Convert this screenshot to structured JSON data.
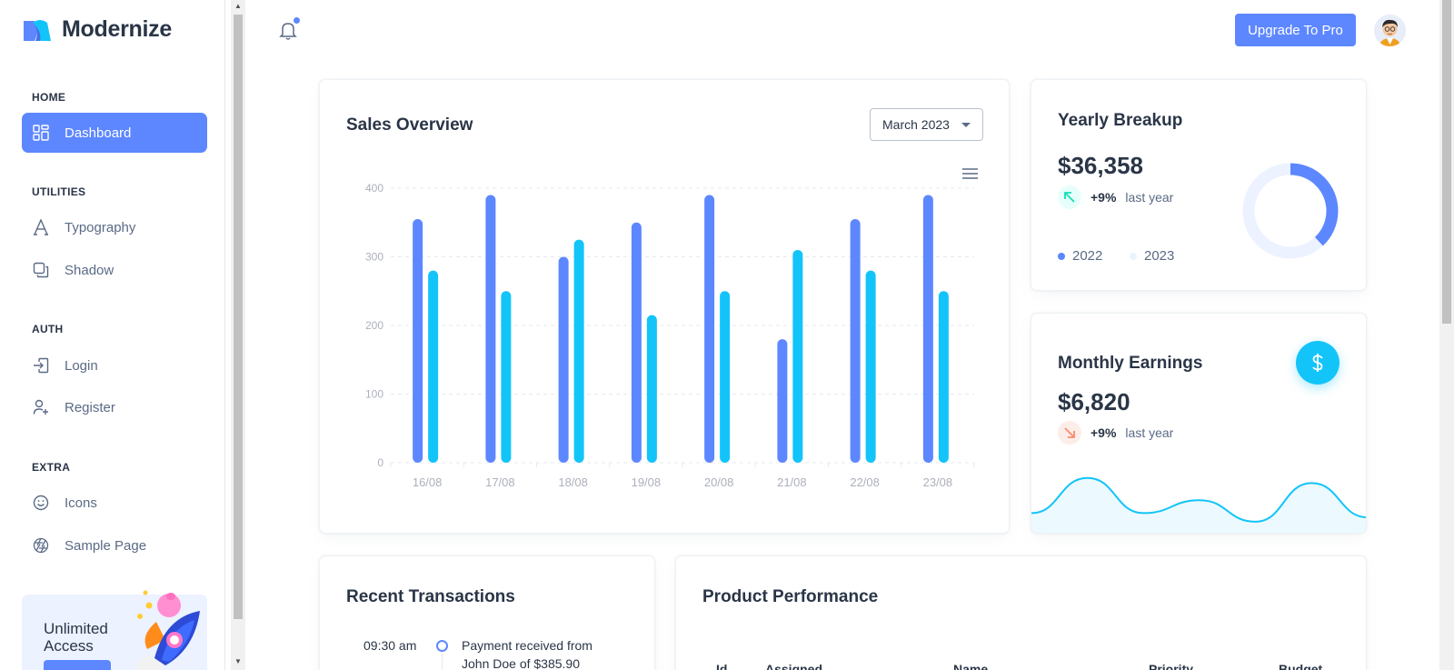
{
  "brand": {
    "name": "Modernize",
    "colors": {
      "primary": "#5d87ff",
      "secondary": "#13c4f9",
      "success": "#13deb9",
      "error": "#fa896b"
    }
  },
  "sidebar": {
    "sections": [
      {
        "title": "HOME",
        "items": [
          {
            "label": "Dashboard",
            "icon": "dashboard-icon",
            "active": true
          }
        ]
      },
      {
        "title": "UTILITIES",
        "items": [
          {
            "label": "Typography",
            "icon": "typography-icon"
          },
          {
            "label": "Shadow",
            "icon": "shadow-icon"
          }
        ]
      },
      {
        "title": "AUTH",
        "items": [
          {
            "label": "Login",
            "icon": "login-icon"
          },
          {
            "label": "Register",
            "icon": "user-plus-icon"
          }
        ]
      },
      {
        "title": "EXTRA",
        "items": [
          {
            "label": "Icons",
            "icon": "mood-smile-icon"
          },
          {
            "label": "Sample Page",
            "icon": "aperture-icon"
          }
        ]
      }
    ],
    "promo": {
      "title": "Unlimited Access"
    }
  },
  "topbar": {
    "upgrade_label": "Upgrade To Pro"
  },
  "sales_overview": {
    "title": "Sales Overview",
    "month_select": "March 2023"
  },
  "yearly_breakup": {
    "title": "Yearly Breakup",
    "amount": "$36,358",
    "change": "+9%",
    "change_label": "last year",
    "legend": [
      "2022",
      "2023"
    ]
  },
  "monthly_earnings": {
    "title": "Monthly Earnings",
    "amount": "$6,820",
    "change": "+9%",
    "change_label": "last year"
  },
  "recent_transactions": {
    "title": "Recent Transactions",
    "items": [
      {
        "time": "09:30 am",
        "text": "Payment received from John Doe of $385.90"
      }
    ]
  },
  "product_performance": {
    "title": "Product Performance",
    "columns": [
      "Id",
      "Assigned",
      "Name",
      "Priority",
      "Budget"
    ]
  },
  "chart_data": [
    {
      "type": "bar",
      "categories": [
        "16/08",
        "17/08",
        "18/08",
        "19/08",
        "20/08",
        "21/08",
        "22/08",
        "23/08"
      ],
      "series": [
        {
          "values": [
            355,
            390,
            300,
            350,
            390,
            180,
            355,
            390
          ],
          "color": "#5d87ff"
        },
        {
          "values": [
            280,
            250,
            325,
            215,
            250,
            310,
            280,
            250
          ],
          "color": "#13c4f9"
        }
      ],
      "yticks": [
        0,
        100,
        200,
        300,
        400
      ],
      "ylim": [
        0,
        400
      ],
      "grid": true
    },
    {
      "type": "pie",
      "values": [
        38,
        62
      ],
      "labels": [
        "2022",
        "2023"
      ],
      "colors": [
        "#5d87ff",
        "#ecf2ff"
      ]
    },
    {
      "type": "area",
      "values": [
        25,
        66,
        25,
        40,
        15,
        60,
        20
      ],
      "color": "#13c4f9"
    }
  ]
}
